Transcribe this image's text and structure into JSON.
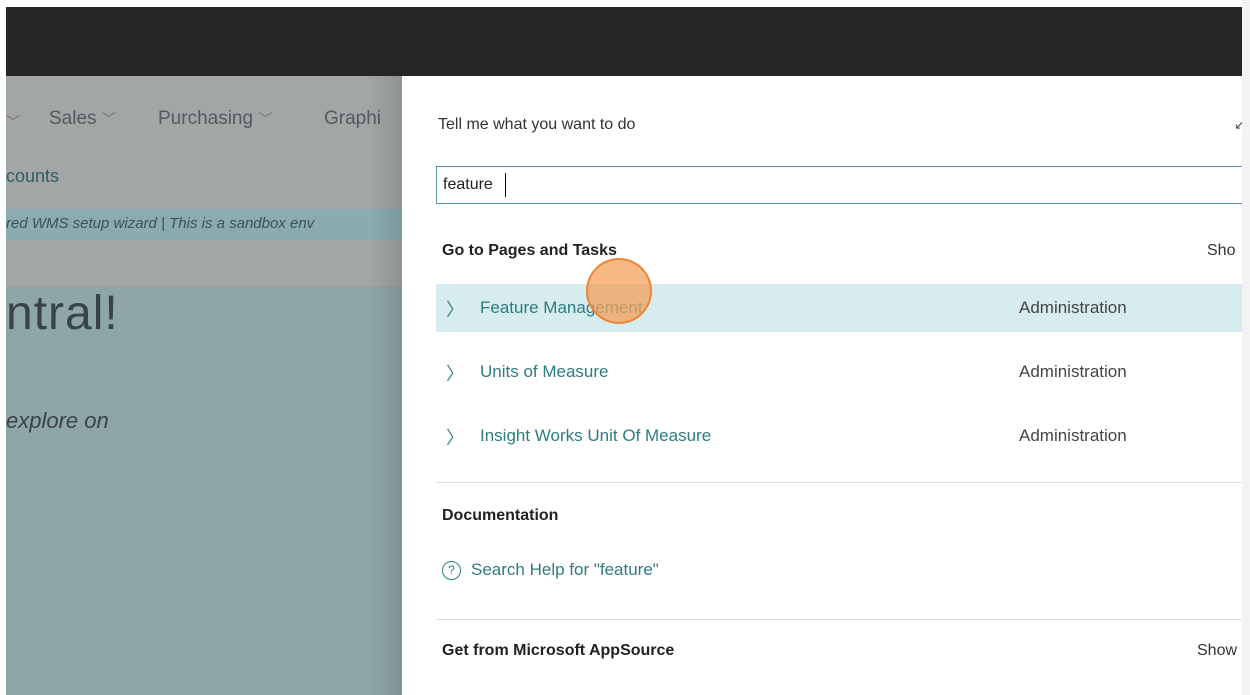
{
  "background_app": {
    "nav": [
      {
        "label": "Sales"
      },
      {
        "label": "Purchasing"
      },
      {
        "label": "Graphi"
      }
    ],
    "sublink": "counts",
    "banner": "red WMS setup wizard  |  This is a sandbox env",
    "hero_title": "ntral!",
    "hero_subtitle": "explore on"
  },
  "panel": {
    "title": "Tell me what you want to do",
    "search": {
      "value": "feature"
    },
    "sections": {
      "pages_tasks": {
        "heading": "Go to Pages and Tasks",
        "show_label": "Sho"
      },
      "documentation": {
        "heading": "Documentation",
        "help_link": "Search Help for \"feature\""
      },
      "appsource": {
        "heading": "Get from Microsoft AppSource",
        "show_label": "Show"
      }
    },
    "results": [
      {
        "label": "Feature Management",
        "category": "Administration"
      },
      {
        "label": "Units of Measure",
        "category": "Administration"
      },
      {
        "label": "Insight Works Unit Of Measure",
        "category": "Administration"
      }
    ]
  },
  "colors": {
    "accent": "#2d7c82",
    "highlight_row": "#d6ecee",
    "topbar": "#262626",
    "click_indicator": "#f4a05a"
  }
}
